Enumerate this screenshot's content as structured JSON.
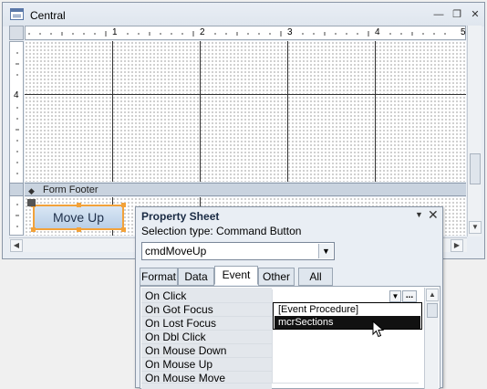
{
  "window": {
    "title": "Central",
    "minimize_glyph": "—",
    "restore_glyph": "❐",
    "close_glyph": "✕"
  },
  "ruler": {
    "h_labels": [
      "1",
      "2",
      "3",
      "4",
      "5"
    ],
    "v_label": "4"
  },
  "form": {
    "footer_label": "Form Footer",
    "button_label": "Move Up"
  },
  "property_sheet": {
    "title": "Property Sheet",
    "selection_type": "Selection type:  Command Button",
    "object_name": "cmdMoveUp",
    "tabs": [
      "Format",
      "Data",
      "Event",
      "Other",
      "All"
    ],
    "active_tab": "Event",
    "properties": [
      {
        "name": "On Click",
        "value": ""
      },
      {
        "name": "On Got Focus",
        "value": ""
      },
      {
        "name": "On Lost Focus",
        "value": ""
      },
      {
        "name": "On Dbl Click",
        "value": ""
      },
      {
        "name": "On Mouse Down",
        "value": ""
      },
      {
        "name": "On Mouse Up",
        "value": ""
      },
      {
        "name": "On Mouse Move",
        "value": ""
      }
    ],
    "build_button": "...",
    "dropdown_options": [
      "[Event Procedure]",
      "mcrSections"
    ],
    "dropdown_selected": "mcrSections"
  },
  "colors": {
    "selection_handle": "#f2a23a",
    "dropdown_highlight": "#111111"
  }
}
